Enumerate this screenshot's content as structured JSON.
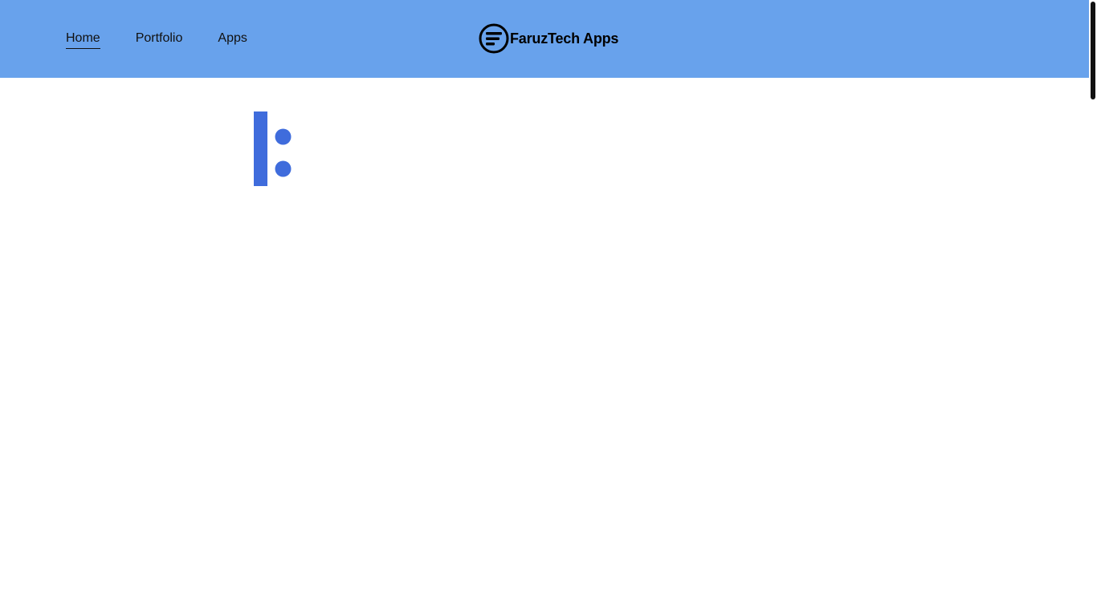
{
  "nav": {
    "items": [
      {
        "label": "Home",
        "active": true
      },
      {
        "label": "Portfolio",
        "active": false
      },
      {
        "label": "Apps",
        "active": false
      }
    ]
  },
  "brand": {
    "name": "FaruzTech Apps",
    "icon": "faruztech-logo-icon"
  },
  "content": {
    "icon": "ratio-icon"
  },
  "colors": {
    "header_bg": "#68a2ec",
    "accent": "#3f6cdc",
    "text": "#111111",
    "background": "#ffffff"
  }
}
